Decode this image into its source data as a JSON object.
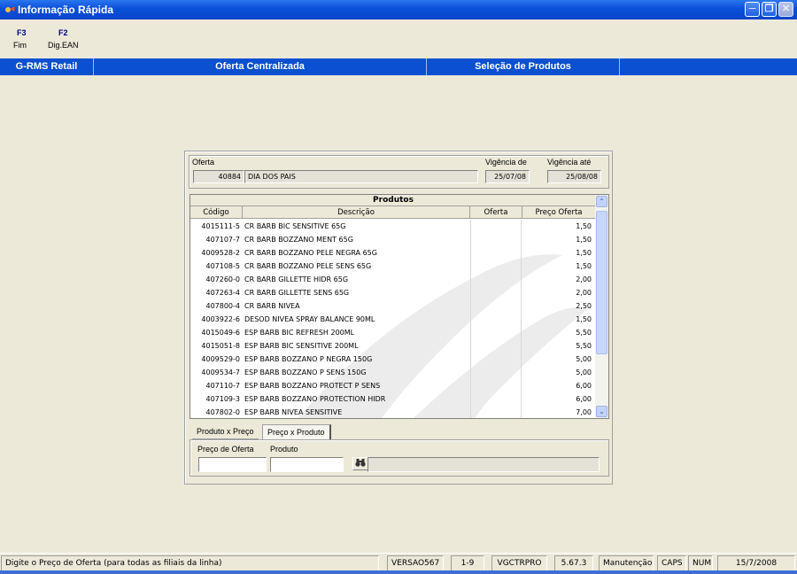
{
  "window": {
    "title": "Informação Rápida",
    "controls": [
      "minimize-icon",
      "restore-icon",
      "close-icon"
    ]
  },
  "fkeys": [
    {
      "key": "F3",
      "label": "Fim"
    },
    {
      "key": "F2",
      "label": "Dig.EAN"
    }
  ],
  "nav": {
    "app": "G-RMS Retail",
    "module": "Oferta Centralizada",
    "screen": "Seleção de Produtos"
  },
  "offer": {
    "label": "Oferta",
    "code": "40884",
    "name": "DIA DOS PAIS",
    "start_label": "Vigência de",
    "start": "25/07/08",
    "end_label": "Vigência até",
    "end": "25/08/08"
  },
  "grid": {
    "title": "Produtos",
    "columns": [
      "Código",
      "Descrição",
      "Oferta",
      "Preço Oferta"
    ],
    "rows": [
      {
        "code": "4015111-5",
        "desc": "CR BARB BIC SENSITIVE 65G",
        "offer": "",
        "price": "1,50"
      },
      {
        "code": "407107-7",
        "desc": "CR BARB BOZZANO MENT 65G",
        "offer": "",
        "price": "1,50"
      },
      {
        "code": "4009528-2",
        "desc": "CR BARB BOZZANO PELE NEGRA 65G",
        "offer": "",
        "price": "1,50"
      },
      {
        "code": "407108-5",
        "desc": "CR BARB BOZZANO PELE SENS 65G",
        "offer": "",
        "price": "1,50"
      },
      {
        "code": "407260-0",
        "desc": "CR BARB GILLETTE HIDR 65G",
        "offer": "",
        "price": "2,00"
      },
      {
        "code": "407263-4",
        "desc": "CR BARB GILLETTE SENS 65G",
        "offer": "",
        "price": "2,00"
      },
      {
        "code": "407800-4",
        "desc": "CR BARB NIVEA",
        "offer": "",
        "price": "2,50"
      },
      {
        "code": "4003922-6",
        "desc": "DESOD NIVEA SPRAY BALANCE 90ML",
        "offer": "",
        "price": "1,50"
      },
      {
        "code": "4015049-6",
        "desc": "ESP BARB BIC REFRESH 200ML",
        "offer": "",
        "price": "5,50"
      },
      {
        "code": "4015051-8",
        "desc": "ESP BARB BIC SENSITIVE 200ML",
        "offer": "",
        "price": "5,50"
      },
      {
        "code": "4009529-0",
        "desc": "ESP BARB BOZZANO P NEGRA 150G",
        "offer": "",
        "price": "5,00"
      },
      {
        "code": "4009534-7",
        "desc": "ESP BARB BOZZANO P SENS 150G",
        "offer": "",
        "price": "5,00"
      },
      {
        "code": "407110-7",
        "desc": "ESP BARB BOZZANO PROTECT P SENS",
        "offer": "",
        "price": "6,00"
      },
      {
        "code": "407109-3",
        "desc": "ESP BARB BOZZANO PROTECTION HIDR",
        "offer": "",
        "price": "6,00"
      },
      {
        "code": "407802-0",
        "desc": "ESP BARB NIVEA SENSITIVE",
        "offer": "",
        "price": "7,00"
      }
    ]
  },
  "tabs": [
    {
      "label": "Produto x Preço",
      "active": false
    },
    {
      "label": "Preço x Produto",
      "active": true
    }
  ],
  "search": {
    "price_label": "Preço de Oferta",
    "price_value": "",
    "product_label": "Produto",
    "product_value": "",
    "product_desc": "",
    "search_icon": "binoculars-icon"
  },
  "status": {
    "message": "Digite o Preço de Oferta (para todas as filiais da linha)",
    "version": "VERSAO567",
    "page": "1-9",
    "program": "VGCTRPRO",
    "build": "5.67.3",
    "mode": "Manutenção",
    "caps": "CAPS",
    "num": "NUM",
    "date": "15/7/2008"
  },
  "colors": {
    "titlebar": "#0a50d0",
    "navbar": "#0a50d0",
    "fkey": "#000080",
    "background": "#ece9d8"
  }
}
